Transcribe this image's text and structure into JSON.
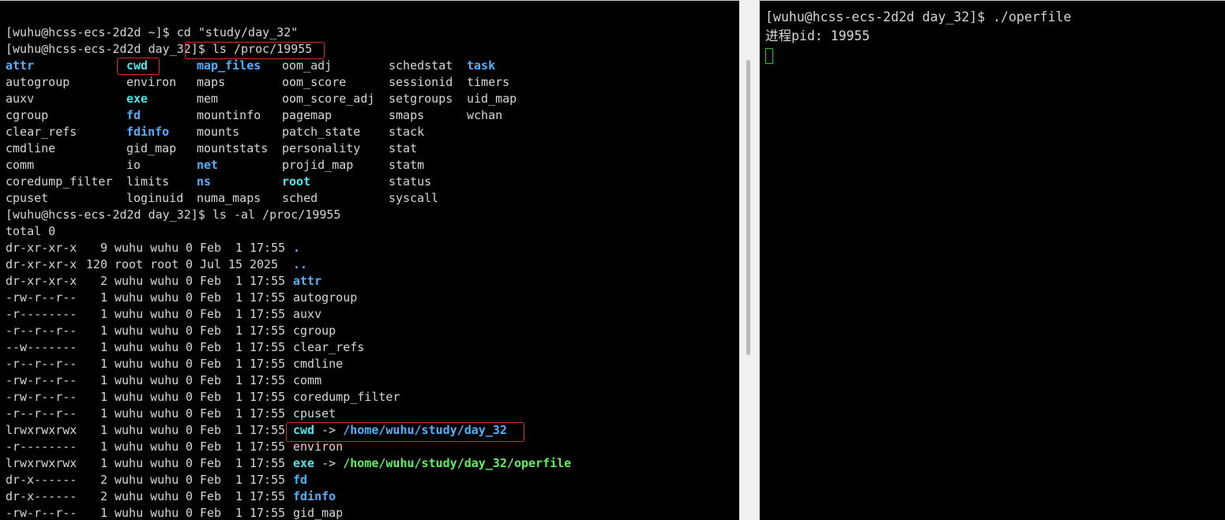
{
  "left": {
    "pre": [
      "[wuhu@hcss-ecs-2d2d ~]$ cd \"study/day_32\"",
      "[wuhu@hcss-ecs-2d2d day_32]$ ls /proc/19955"
    ],
    "grid": [
      [
        {
          "t": "attr",
          "c": "blue"
        },
        {
          "t": "cwd",
          "c": "cyan"
        },
        {
          "t": "map_files",
          "c": "blue"
        },
        {
          "t": "oom_adj",
          "c": ""
        },
        {
          "t": "schedstat",
          "c": ""
        },
        {
          "t": "task",
          "c": "blue"
        }
      ],
      [
        {
          "t": "autogroup",
          "c": ""
        },
        {
          "t": "environ",
          "c": ""
        },
        {
          "t": "maps",
          "c": ""
        },
        {
          "t": "oom_score",
          "c": ""
        },
        {
          "t": "sessionid",
          "c": ""
        },
        {
          "t": "timers",
          "c": ""
        }
      ],
      [
        {
          "t": "auxv",
          "c": ""
        },
        {
          "t": "exe",
          "c": "cyan"
        },
        {
          "t": "mem",
          "c": ""
        },
        {
          "t": "oom_score_adj",
          "c": ""
        },
        {
          "t": "setgroups",
          "c": ""
        },
        {
          "t": "uid_map",
          "c": ""
        }
      ],
      [
        {
          "t": "cgroup",
          "c": ""
        },
        {
          "t": "fd",
          "c": "blue"
        },
        {
          "t": "mountinfo",
          "c": ""
        },
        {
          "t": "pagemap",
          "c": ""
        },
        {
          "t": "smaps",
          "c": ""
        },
        {
          "t": "wchan",
          "c": ""
        }
      ],
      [
        {
          "t": "clear_refs",
          "c": ""
        },
        {
          "t": "fdinfo",
          "c": "blue"
        },
        {
          "t": "mounts",
          "c": ""
        },
        {
          "t": "patch_state",
          "c": ""
        },
        {
          "t": "stack",
          "c": ""
        },
        {
          "t": "",
          "c": ""
        }
      ],
      [
        {
          "t": "cmdline",
          "c": ""
        },
        {
          "t": "gid_map",
          "c": ""
        },
        {
          "t": "mountstats",
          "c": ""
        },
        {
          "t": "personality",
          "c": ""
        },
        {
          "t": "stat",
          "c": ""
        },
        {
          "t": "",
          "c": ""
        }
      ],
      [
        {
          "t": "comm",
          "c": ""
        },
        {
          "t": "io",
          "c": ""
        },
        {
          "t": "net",
          "c": "blue"
        },
        {
          "t": "projid_map",
          "c": ""
        },
        {
          "t": "statm",
          "c": ""
        },
        {
          "t": "",
          "c": ""
        }
      ],
      [
        {
          "t": "coredump_filter",
          "c": ""
        },
        {
          "t": "limits",
          "c": ""
        },
        {
          "t": "ns",
          "c": "blue"
        },
        {
          "t": "root",
          "c": "cyan"
        },
        {
          "t": "status",
          "c": ""
        },
        {
          "t": "",
          "c": ""
        }
      ],
      [
        {
          "t": "cpuset",
          "c": ""
        },
        {
          "t": "loginuid",
          "c": ""
        },
        {
          "t": "numa_maps",
          "c": ""
        },
        {
          "t": "sched",
          "c": ""
        },
        {
          "t": "syscall",
          "c": ""
        },
        {
          "t": "",
          "c": ""
        }
      ]
    ],
    "cmd2": "[wuhu@hcss-ecs-2d2d day_32]$ ls -al /proc/19955",
    "total": "total 0",
    "listing": [
      {
        "perm": "dr-xr-xr-x",
        "links": "9",
        "owner": "wuhu wuhu",
        "size": "0",
        "month": "Feb",
        "day": "1",
        "time": "17:55",
        "name": ".",
        "cls": "blue",
        "target": "",
        "tcls": ""
      },
      {
        "perm": "dr-xr-xr-x",
        "links": "120",
        "owner": "root root",
        "size": "0",
        "month": "Jul",
        "day": "15",
        "time": "2025",
        "name": "..",
        "cls": "blue",
        "target": "",
        "tcls": ""
      },
      {
        "perm": "dr-xr-xr-x",
        "links": "2",
        "owner": "wuhu wuhu",
        "size": "0",
        "month": "Feb",
        "day": "1",
        "time": "17:55",
        "name": "attr",
        "cls": "blue",
        "target": "",
        "tcls": ""
      },
      {
        "perm": "-rw-r--r--",
        "links": "1",
        "owner": "wuhu wuhu",
        "size": "0",
        "month": "Feb",
        "day": "1",
        "time": "17:55",
        "name": "autogroup",
        "cls": "",
        "target": "",
        "tcls": ""
      },
      {
        "perm": "-r--------",
        "links": "1",
        "owner": "wuhu wuhu",
        "size": "0",
        "month": "Feb",
        "day": "1",
        "time": "17:55",
        "name": "auxv",
        "cls": "",
        "target": "",
        "tcls": ""
      },
      {
        "perm": "-r--r--r--",
        "links": "1",
        "owner": "wuhu wuhu",
        "size": "0",
        "month": "Feb",
        "day": "1",
        "time": "17:55",
        "name": "cgroup",
        "cls": "",
        "target": "",
        "tcls": ""
      },
      {
        "perm": "--w-------",
        "links": "1",
        "owner": "wuhu wuhu",
        "size": "0",
        "month": "Feb",
        "day": "1",
        "time": "17:55",
        "name": "clear_refs",
        "cls": "",
        "target": "",
        "tcls": ""
      },
      {
        "perm": "-r--r--r--",
        "links": "1",
        "owner": "wuhu wuhu",
        "size": "0",
        "month": "Feb",
        "day": "1",
        "time": "17:55",
        "name": "cmdline",
        "cls": "",
        "target": "",
        "tcls": ""
      },
      {
        "perm": "-rw-r--r--",
        "links": "1",
        "owner": "wuhu wuhu",
        "size": "0",
        "month": "Feb",
        "day": "1",
        "time": "17:55",
        "name": "comm",
        "cls": "",
        "target": "",
        "tcls": ""
      },
      {
        "perm": "-rw-r--r--",
        "links": "1",
        "owner": "wuhu wuhu",
        "size": "0",
        "month": "Feb",
        "day": "1",
        "time": "17:55",
        "name": "coredump_filter",
        "cls": "",
        "target": "",
        "tcls": ""
      },
      {
        "perm": "-r--r--r--",
        "links": "1",
        "owner": "wuhu wuhu",
        "size": "0",
        "month": "Feb",
        "day": "1",
        "time": "17:55",
        "name": "cpuset",
        "cls": "",
        "target": "",
        "tcls": ""
      },
      {
        "perm": "lrwxrwxrwx",
        "links": "1",
        "owner": "wuhu wuhu",
        "size": "0",
        "month": "Feb",
        "day": "1",
        "time": "17:55",
        "name": "cwd",
        "cls": "cyan",
        "target": "/home/wuhu/study/day_32",
        "tcls": "blue"
      },
      {
        "perm": "-r--------",
        "links": "1",
        "owner": "wuhu wuhu",
        "size": "0",
        "month": "Feb",
        "day": "1",
        "time": "17:55",
        "name": "environ",
        "cls": "",
        "target": "",
        "tcls": ""
      },
      {
        "perm": "lrwxrwxrwx",
        "links": "1",
        "owner": "wuhu wuhu",
        "size": "0",
        "month": "Feb",
        "day": "1",
        "time": "17:55",
        "name": "exe",
        "cls": "cyan",
        "target": "/home/wuhu/study/day_32/operfile",
        "tcls": "green"
      },
      {
        "perm": "dr-x------",
        "links": "2",
        "owner": "wuhu wuhu",
        "size": "0",
        "month": "Feb",
        "day": "1",
        "time": "17:55",
        "name": "fd",
        "cls": "blue",
        "target": "",
        "tcls": ""
      },
      {
        "perm": "dr-x------",
        "links": "2",
        "owner": "wuhu wuhu",
        "size": "0",
        "month": "Feb",
        "day": "1",
        "time": "17:55",
        "name": "fdinfo",
        "cls": "blue",
        "target": "",
        "tcls": ""
      },
      {
        "perm": "-rw-r--r--",
        "links": "1",
        "owner": "wuhu wuhu",
        "size": "0",
        "month": "Feb",
        "day": "1",
        "time": "17:55",
        "name": "gid_map",
        "cls": "",
        "target": "",
        "tcls": ""
      }
    ]
  },
  "right": {
    "line1": "[wuhu@hcss-ecs-2d2d day_32]$ ./operfile",
    "line2_label": "进程",
    "line2_value": "pid: 19955"
  },
  "colors": {
    "terminal_bg": "#000000",
    "text": "#d6d6d6",
    "dir_blue": "#4fb2ff",
    "link_cyan": "#4ce6ec",
    "exec_green": "#5ef25e",
    "highlight_red": "#e02a2a"
  }
}
